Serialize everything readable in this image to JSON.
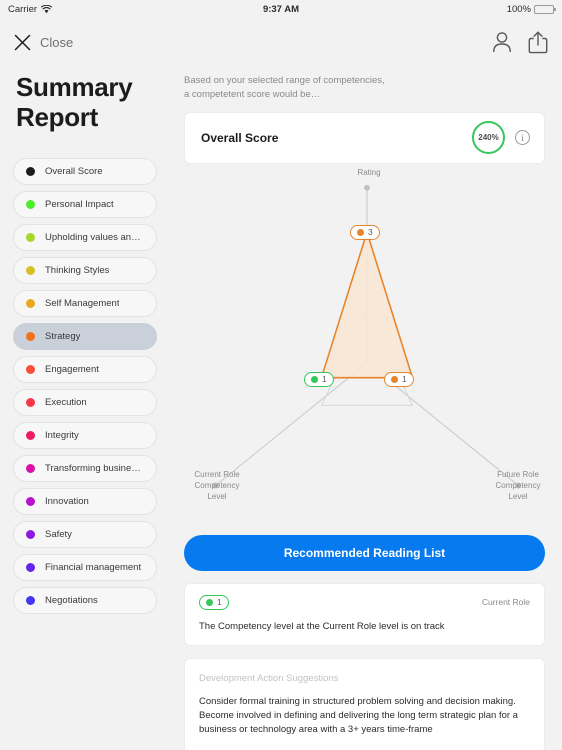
{
  "status_bar": {
    "carrier": "Carrier",
    "wifi_icon": "wifi-icon",
    "time": "9:37 AM",
    "battery_percent": "100%"
  },
  "nav": {
    "close_label": "Close",
    "profile_icon": "person-icon",
    "share_icon": "share-icon"
  },
  "sidebar": {
    "title": "Summary\nReport",
    "title_line1": "Summary",
    "title_line2": "Report",
    "items": [
      {
        "label": "Overall Score",
        "color": "#1c1c1e",
        "selected": false
      },
      {
        "label": "Personal Impact",
        "color": "#4ced2c",
        "selected": false
      },
      {
        "label": "Upholding values and goals",
        "color": "#a6d82b",
        "selected": false
      },
      {
        "label": "Thinking Styles",
        "color": "#d6c226",
        "selected": false
      },
      {
        "label": "Self Management",
        "color": "#e9a81f",
        "selected": false
      },
      {
        "label": "Strategy",
        "color": "#f1701d",
        "selected": true
      },
      {
        "label": "Engagement",
        "color": "#f94f38",
        "selected": false
      },
      {
        "label": "Execution",
        "color": "#f6374c",
        "selected": false
      },
      {
        "label": "Integrity",
        "color": "#ec1e63",
        "selected": false
      },
      {
        "label": "Transforming businesses",
        "color": "#d911a8",
        "selected": false
      },
      {
        "label": "Innovation",
        "color": "#b514cc",
        "selected": false
      },
      {
        "label": "Safety",
        "color": "#8f1ae0",
        "selected": false
      },
      {
        "label": "Financial management",
        "color": "#6426ee",
        "selected": false
      },
      {
        "label": "Negotiations",
        "color": "#4336f5",
        "selected": false
      }
    ]
  },
  "main": {
    "intro_line1": "Based on your selected range of competencies,",
    "intro_line2": "a competetent score would be…",
    "score_card": {
      "title": "Overall Score",
      "value": "240%",
      "ring_color": "#39c65d",
      "info_icon": "info-icon",
      "info_glyph": "i"
    },
    "cta_label": "Recommended Reading List",
    "track_card": {
      "badge_value": "1",
      "badge_color": "#34c759",
      "role_label": "Current Role",
      "text": "The Competency level at the Current Role level is on track"
    },
    "dev_card": {
      "title": "Development Action Suggestions",
      "body": "Consider formal training in structured problem solving and decision making. Become involved in defining and delivering the long term strategic plan for a business or technology area with a 3+ years time-frame"
    }
  },
  "chart_data": {
    "type": "radar",
    "title": "",
    "axes": [
      {
        "name": "Rating",
        "label": "Rating",
        "label_lines": [
          "Rating"
        ],
        "value": 3,
        "max": 5,
        "node_color": "#e8832a"
      },
      {
        "name": "Future Role Competency Level",
        "label": "Future Role Competency Level",
        "label_lines": [
          "Future Role",
          "Competency",
          "Level"
        ],
        "value": 1,
        "max": 5,
        "node_color": "#e8832a"
      },
      {
        "name": "Current Role Competency Level",
        "label": "Current Role Competency Level",
        "label_lines": [
          "Current Role",
          "Competency",
          "Level"
        ],
        "value": 1,
        "max": 5,
        "node_color": "#34c759"
      }
    ],
    "series": [
      {
        "name": "Strategy",
        "values": [
          3,
          1,
          1
        ]
      }
    ],
    "node_labels": {
      "rating": "3",
      "future_role": "1",
      "current_role": "1"
    },
    "fill_color": "#f9e6d4",
    "stroke_color": "#e8832a",
    "grid_color": "#c8c8cc",
    "grid": true,
    "legend_position": "none"
  }
}
